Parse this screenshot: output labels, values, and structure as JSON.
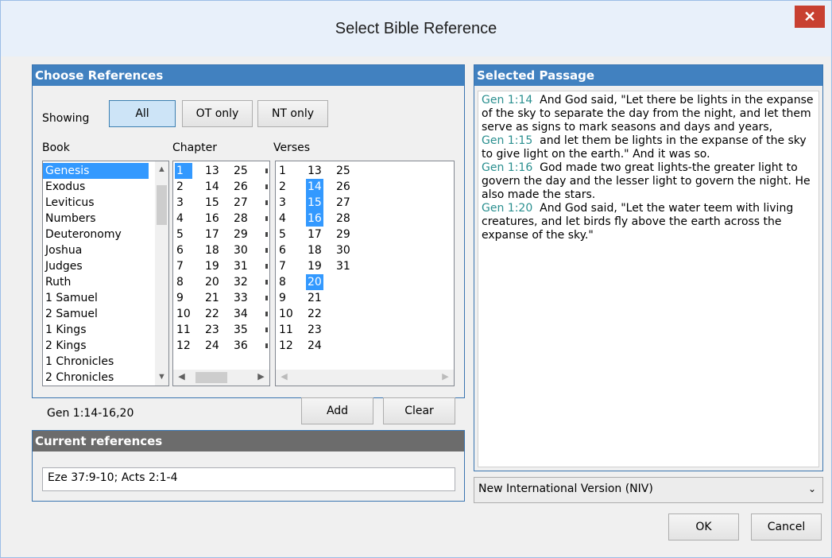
{
  "window": {
    "title": "Select Bible Reference",
    "close_glyph": "✕"
  },
  "choose": {
    "header": "Choose References",
    "showing_label": "Showing",
    "filter_buttons": [
      "All",
      "OT only",
      "NT only"
    ],
    "book_label": "Book",
    "chapter_label": "Chapter",
    "verses_label": "Verses",
    "books": [
      "Genesis",
      "Exodus",
      "Leviticus",
      "Numbers",
      "Deuteronomy",
      "Joshua",
      "Judges",
      "Ruth",
      "1 Samuel",
      "2 Samuel",
      "1 Kings",
      "2 Kings",
      "1 Chronicles",
      "2 Chronicles"
    ],
    "selected_book": "Genesis",
    "chapter_columns": [
      [
        "1",
        "2",
        "3",
        "4",
        "5",
        "6",
        "7",
        "8",
        "9",
        "10",
        "11",
        "12"
      ],
      [
        "13",
        "14",
        "15",
        "16",
        "17",
        "18",
        "19",
        "20",
        "21",
        "22",
        "23",
        "24"
      ],
      [
        "25",
        "26",
        "27",
        "28",
        "29",
        "30",
        "31",
        "32",
        "33",
        "34",
        "35",
        "36"
      ]
    ],
    "selected_chapter": "1",
    "verse_columns": [
      [
        "1",
        "2",
        "3",
        "4",
        "5",
        "6",
        "7",
        "8",
        "9",
        "10",
        "11",
        "12"
      ],
      [
        "13",
        "14",
        "15",
        "16",
        "17",
        "18",
        "19",
        "20",
        "21",
        "22",
        "23",
        "24"
      ],
      [
        "25",
        "26",
        "27",
        "28",
        "29",
        "30",
        "31"
      ]
    ],
    "selected_verses": [
      "14",
      "15",
      "16",
      "20"
    ],
    "current_selection": "Gen 1:14-16,20",
    "add_label": "Add",
    "clear_label": "Clear"
  },
  "current": {
    "header": "Current references",
    "value": "Eze 37:9-10; Acts 2:1-4"
  },
  "passage": {
    "header": "Selected Passage",
    "verses": [
      {
        "ref": "Gen 1:14",
        "text": "And God said, \"Let there be lights in the expanse of the sky to separate the day from the night, and let them serve as signs to mark seasons and days and years,"
      },
      {
        "ref": "Gen 1:15",
        "text": "and let them be lights in the expanse of the sky to give light on the earth.\" And it was so."
      },
      {
        "ref": "Gen 1:16",
        "text": "God made two great lights-the greater light to govern the day and the lesser light to govern the night. He also made the stars."
      },
      {
        "ref": "Gen 1:20",
        "text": "And God said, \"Let the water teem with living creatures, and let birds fly above the earth across the expanse of the sky.\""
      }
    ],
    "version": "New International Version (NIV)"
  },
  "footer": {
    "ok_label": "OK",
    "cancel_label": "Cancel"
  },
  "colors": {
    "panel_header": "#4181c0",
    "selection": "#3399ff",
    "reference_text": "#2a8f8f",
    "close_button": "#c84031"
  }
}
